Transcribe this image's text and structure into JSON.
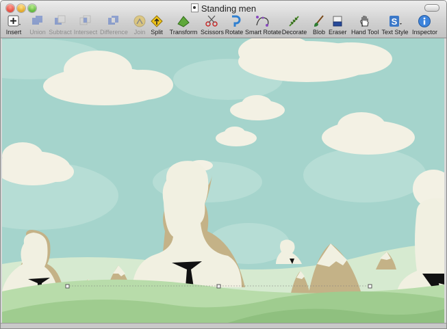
{
  "window": {
    "title": "Standing men",
    "controls": [
      "close",
      "minimize",
      "zoom"
    ]
  },
  "toolbar": {
    "items": [
      {
        "label": "Insert",
        "icon": "plus-icon",
        "enabled": true
      },
      {
        "label": "Union",
        "icon": "union-icon",
        "enabled": false
      },
      {
        "label": "Subtract",
        "icon": "subtract-icon",
        "enabled": false
      },
      {
        "label": "Intersect",
        "icon": "intersect-icon",
        "enabled": false
      },
      {
        "label": "Difference",
        "icon": "difference-icon",
        "enabled": false
      },
      {
        "label": "Join",
        "icon": "join-icon",
        "enabled": false
      },
      {
        "label": "Split",
        "icon": "split-icon",
        "enabled": true
      },
      {
        "label": "Transform",
        "icon": "transform-icon",
        "enabled": true
      },
      {
        "label": "Scissors",
        "icon": "scissors-icon",
        "enabled": true
      },
      {
        "label": "Rotate",
        "icon": "rotate-icon",
        "enabled": true
      },
      {
        "label": "Smart Rotate",
        "icon": "smart-rotate-icon",
        "enabled": true
      },
      {
        "label": "Decorate",
        "icon": "decorate-icon",
        "enabled": true
      },
      {
        "label": "Blob",
        "icon": "blob-brush-icon",
        "enabled": true
      },
      {
        "label": "Eraser",
        "icon": "eraser-icon",
        "enabled": true
      },
      {
        "label": "Hand Tool",
        "icon": "hand-icon",
        "enabled": true
      },
      {
        "label": "Text Style",
        "icon": "text-style-icon",
        "enabled": true
      },
      {
        "label": "Inspector",
        "icon": "info-icon",
        "enabled": true
      }
    ]
  },
  "colors": {
    "sky": "#a5d4cc",
    "cloud": "#f3f1e4",
    "silhouette": "#f1f0e1",
    "silhouette_shadow": "#c4b287",
    "hill_light": "#d6ead0",
    "hill_mid": "#b8dcaa",
    "hill_dark": "#9fcc8f",
    "tie": "#111111"
  }
}
